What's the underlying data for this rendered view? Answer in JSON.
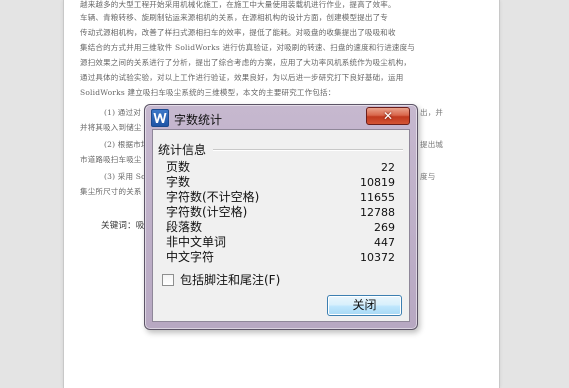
{
  "document": {
    "lines": [
      "越来越多的大型工程开始采用机械化施工，在施工中大量使用装载机进行作业，提高了效率。",
      "车辆、青粮转移、旋刷制钻运来源相机的关系，在源相机构的设计方面，创建模型提出了专",
      "传动式源相机构，改善了样扫式源相扫车的效率，提低了能耗。对吸盘的收集提出了吸吸和收",
      "集结合的方式并用三维软件 SolidWorks 进行仿真验证，对吸刷的转速、扫盘的速度和行进速度与",
      "源扫效果之间的关系进行了分析，提出了综合考虑的方案，应用了大功率风机系统作为吸尘机构，",
      "通过具体的试验实验，对以上工作进行验证，效果良好，为以后进一步研究打下良好基础，运用",
      "SolidWorks 建立吸扫车吸尘系统的三维模型，本文的主要研究工作包括：",
      "(1) 通过对",
      "并将其吸入到储尘",
      "(2) 根据市场",
      "市道路吸扫车吸尘",
      "(3) 采用 Soli",
      "集尘所尺寸的关系",
      "关键词：吸"
    ],
    "right_fragments": [
      "出，并",
      "提出城",
      "度与"
    ]
  },
  "dialog": {
    "title": "字数统计",
    "close_symbol": "✕",
    "group_title": "统计信息",
    "stats": [
      {
        "label": "页数",
        "value": "22"
      },
      {
        "label": "字数",
        "value": "10819"
      },
      {
        "label": "字符数(不计空格)",
        "value": "11655"
      },
      {
        "label": "字符数(计空格)",
        "value": "12788"
      },
      {
        "label": "段落数",
        "value": "269"
      },
      {
        "label": "非中文单词",
        "value": "447"
      },
      {
        "label": "中文字符",
        "value": "10372"
      }
    ],
    "include_footnotes_label": "包括脚注和尾注(F)",
    "include_footnotes_checked": false,
    "close_button_label": "关闭"
  },
  "colors": {
    "dialog_frame": "#bfb0c9",
    "close_button": "#c94a2c",
    "ok_button_border": "#3c7fb1",
    "app_icon": "#2a63b3"
  }
}
